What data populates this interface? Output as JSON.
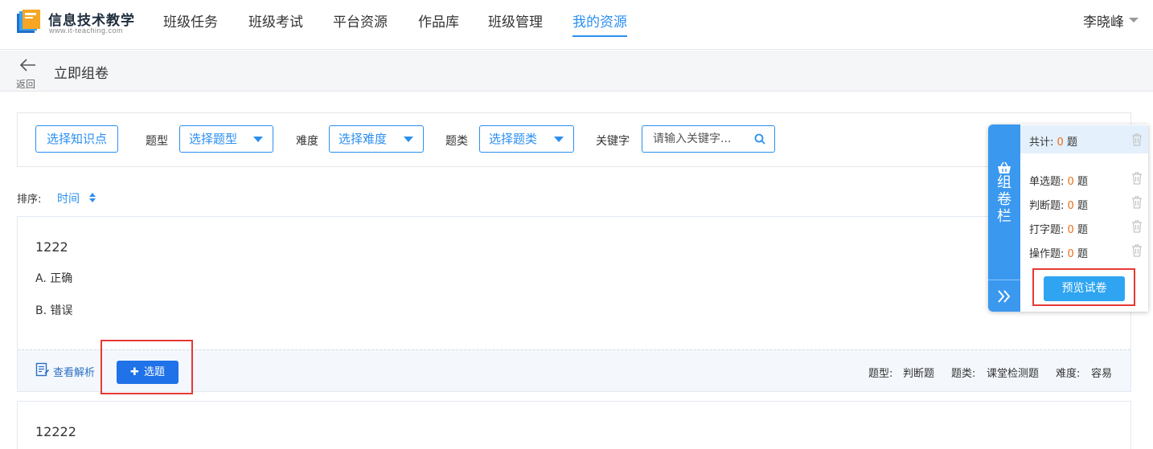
{
  "app": {
    "logo_title": "信息技术教学",
    "logo_sub": "www.it-teaching.com"
  },
  "nav": {
    "items": [
      "班级任务",
      "班级考试",
      "平台资源",
      "作品库",
      "班级管理",
      "我的资源"
    ],
    "active": "我的资源",
    "user_name": "李晓峰"
  },
  "subbar": {
    "back_label": "返回",
    "title": "立即组卷"
  },
  "filter": {
    "knowledge_button": "选择知识点",
    "type_label": "题型",
    "type_select": "选择题型",
    "difficulty_label": "难度",
    "difficulty_select": "选择难度",
    "category_label": "题类",
    "category_select": "选择题类",
    "keyword_label": "关键字",
    "keyword_placeholder": "请输入关键字..."
  },
  "sort": {
    "label": "排序:",
    "value": "时间"
  },
  "questions": [
    {
      "title": "1222",
      "options": [
        "A. 正确",
        "B. 错误"
      ],
      "analysis_label": "查看解析",
      "select_label": "选题",
      "meta_type_label": "题型:",
      "meta_type": "判断题",
      "meta_category_label": "题类:",
      "meta_category": "课堂检测题",
      "meta_difficulty_label": "难度:",
      "meta_difficulty": "容易"
    },
    {
      "title": "12222"
    }
  ],
  "basket": {
    "tab_title": "组卷栏",
    "total_label": "共计:",
    "total_count": "0",
    "unit": "题",
    "rows": [
      {
        "label": "单选题:",
        "count": "0"
      },
      {
        "label": "判断题:",
        "count": "0"
      },
      {
        "label": "打字题:",
        "count": "0"
      },
      {
        "label": "操作题:",
        "count": "0"
      }
    ],
    "preview_button": "预览试卷"
  },
  "colors": {
    "accent": "#2b8ff0",
    "primary_button": "#1f72e8",
    "highlight": "#e53935",
    "count": "#ee6d14"
  }
}
